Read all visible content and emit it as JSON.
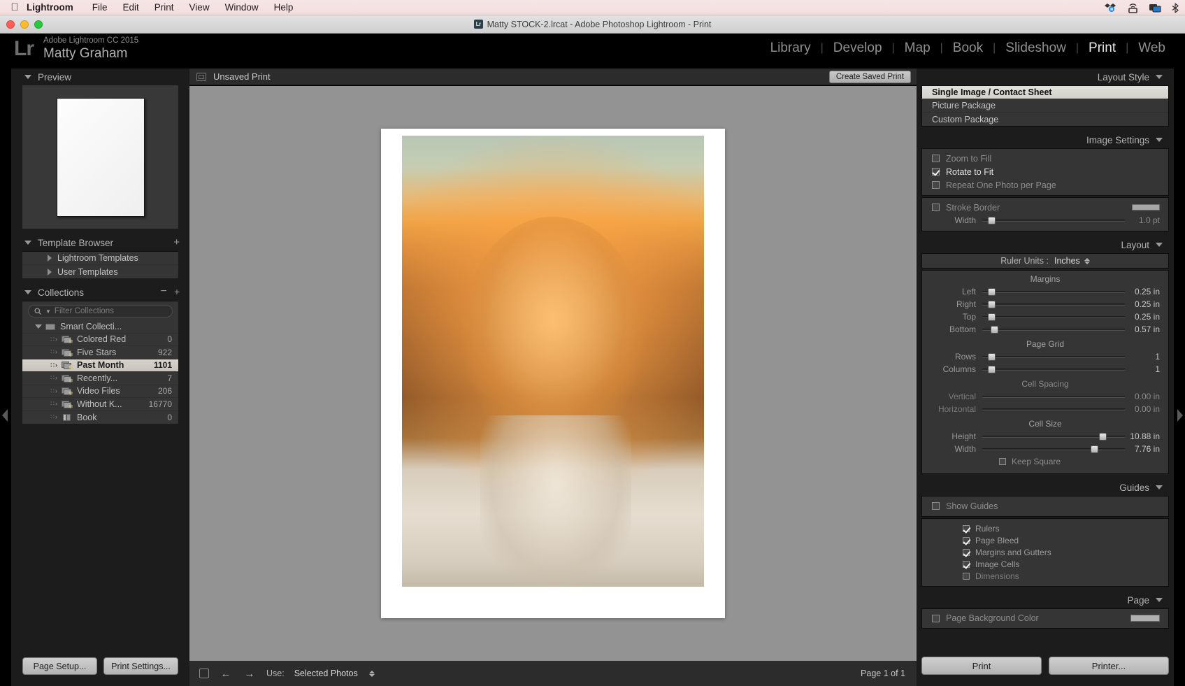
{
  "mac_menu": {
    "apple_icon": "apple-icon",
    "items": [
      "Lightroom",
      "File",
      "Edit",
      "Print",
      "View",
      "Window",
      "Help"
    ],
    "status_icons": [
      "dropbox-icon",
      "airplay-icon",
      "screen-share-icon",
      "bluetooth-icon"
    ]
  },
  "window": {
    "title": "Matty STOCK-2.lrcat - Adobe Photoshop Lightroom - Print",
    "app_icon": "Lr"
  },
  "identity": {
    "logo": "Lr",
    "product": "Adobe Lightroom CC 2015",
    "user": "Matty Graham"
  },
  "modules": {
    "items": [
      "Library",
      "Develop",
      "Map",
      "Book",
      "Slideshow",
      "Print",
      "Web"
    ],
    "active": "Print"
  },
  "left": {
    "preview": {
      "title": "Preview"
    },
    "template_browser": {
      "title": "Template Browser",
      "add_icon": "plus-icon",
      "items": [
        "Lightroom Templates",
        "User Templates"
      ]
    },
    "collections": {
      "title": "Collections",
      "minus_icon": "minus-icon",
      "plus_icon": "plus-icon",
      "filter_placeholder": "Filter Collections",
      "search_icon": "search-icon",
      "group": "Smart Collecti...",
      "items": [
        {
          "name": "Colored Red",
          "count": "0"
        },
        {
          "name": "Five Stars",
          "count": "922"
        },
        {
          "name": "Past Month",
          "count": "1101",
          "selected": true
        },
        {
          "name": "Recently...",
          "count": "7"
        },
        {
          "name": "Video Files",
          "count": "206"
        },
        {
          "name": "Without K...",
          "count": "16770"
        },
        {
          "name": "Book",
          "count": "0",
          "book": true
        }
      ]
    },
    "buttons": {
      "page_setup": "Page Setup...",
      "print_settings": "Print Settings..."
    }
  },
  "center": {
    "header": {
      "title": "Unsaved Print",
      "save_button": "Create Saved Print",
      "page_icon": "page-icon"
    },
    "toolbar": {
      "grid_icon": "grid-view-icon",
      "prev_icon": "previous-page-icon",
      "next_icon": "next-page-icon",
      "use_label": "Use:",
      "use_value": "Selected Photos",
      "page_indicator": "Page 1 of 1"
    }
  },
  "right": {
    "layout_style": {
      "title": "Layout Style",
      "options": [
        "Single Image / Contact Sheet",
        "Picture Package",
        "Custom Package"
      ],
      "selected": "Single Image / Contact Sheet"
    },
    "image_settings": {
      "title": "Image Settings",
      "checks": [
        {
          "label": "Zoom to Fill",
          "checked": false
        },
        {
          "label": "Rotate to Fit",
          "checked": true
        },
        {
          "label": "Repeat One Photo per Page",
          "checked": false
        }
      ],
      "stroke_border": {
        "label": "Stroke Border",
        "checked": false
      },
      "width": {
        "label": "Width",
        "value": "1.0 pt"
      }
    },
    "layout": {
      "title": "Layout",
      "ruler_units_label": "Ruler Units :",
      "ruler_units_value": "Inches",
      "margins_title": "Margins",
      "margins": [
        {
          "label": "Left",
          "value": "0.25 in",
          "pos": 4
        },
        {
          "label": "Right",
          "value": "0.25 in",
          "pos": 4
        },
        {
          "label": "Top",
          "value": "0.25 in",
          "pos": 4
        },
        {
          "label": "Bottom",
          "value": "0.57 in",
          "pos": 6
        }
      ],
      "page_grid_title": "Page Grid",
      "page_grid": [
        {
          "label": "Rows",
          "value": "1",
          "pos": 4
        },
        {
          "label": "Columns",
          "value": "1",
          "pos": 4
        }
      ],
      "cell_spacing_title": "Cell Spacing",
      "cell_spacing": [
        {
          "label": "Vertical",
          "value": "0.00 in",
          "pos": 2
        },
        {
          "label": "Horizontal",
          "value": "0.00 in",
          "pos": 2
        }
      ],
      "cell_size_title": "Cell Size",
      "cell_size": [
        {
          "label": "Height",
          "value": "10.88 in",
          "pos": 82
        },
        {
          "label": "Width",
          "value": "7.76 in",
          "pos": 76
        }
      ],
      "keep_square": {
        "label": "Keep Square",
        "checked": false
      }
    },
    "guides": {
      "title": "Guides",
      "show_guides": {
        "label": "Show Guides",
        "checked": false
      },
      "items": [
        {
          "label": "Rulers",
          "checked": true
        },
        {
          "label": "Page Bleed",
          "checked": true
        },
        {
          "label": "Margins and Gutters",
          "checked": true
        },
        {
          "label": "Image Cells",
          "checked": true
        },
        {
          "label": "Dimensions",
          "checked": false
        }
      ]
    },
    "page": {
      "title": "Page",
      "background_color": {
        "label": "Page Background Color",
        "checked": false
      }
    },
    "buttons": {
      "print": "Print",
      "printer": "Printer..."
    }
  }
}
